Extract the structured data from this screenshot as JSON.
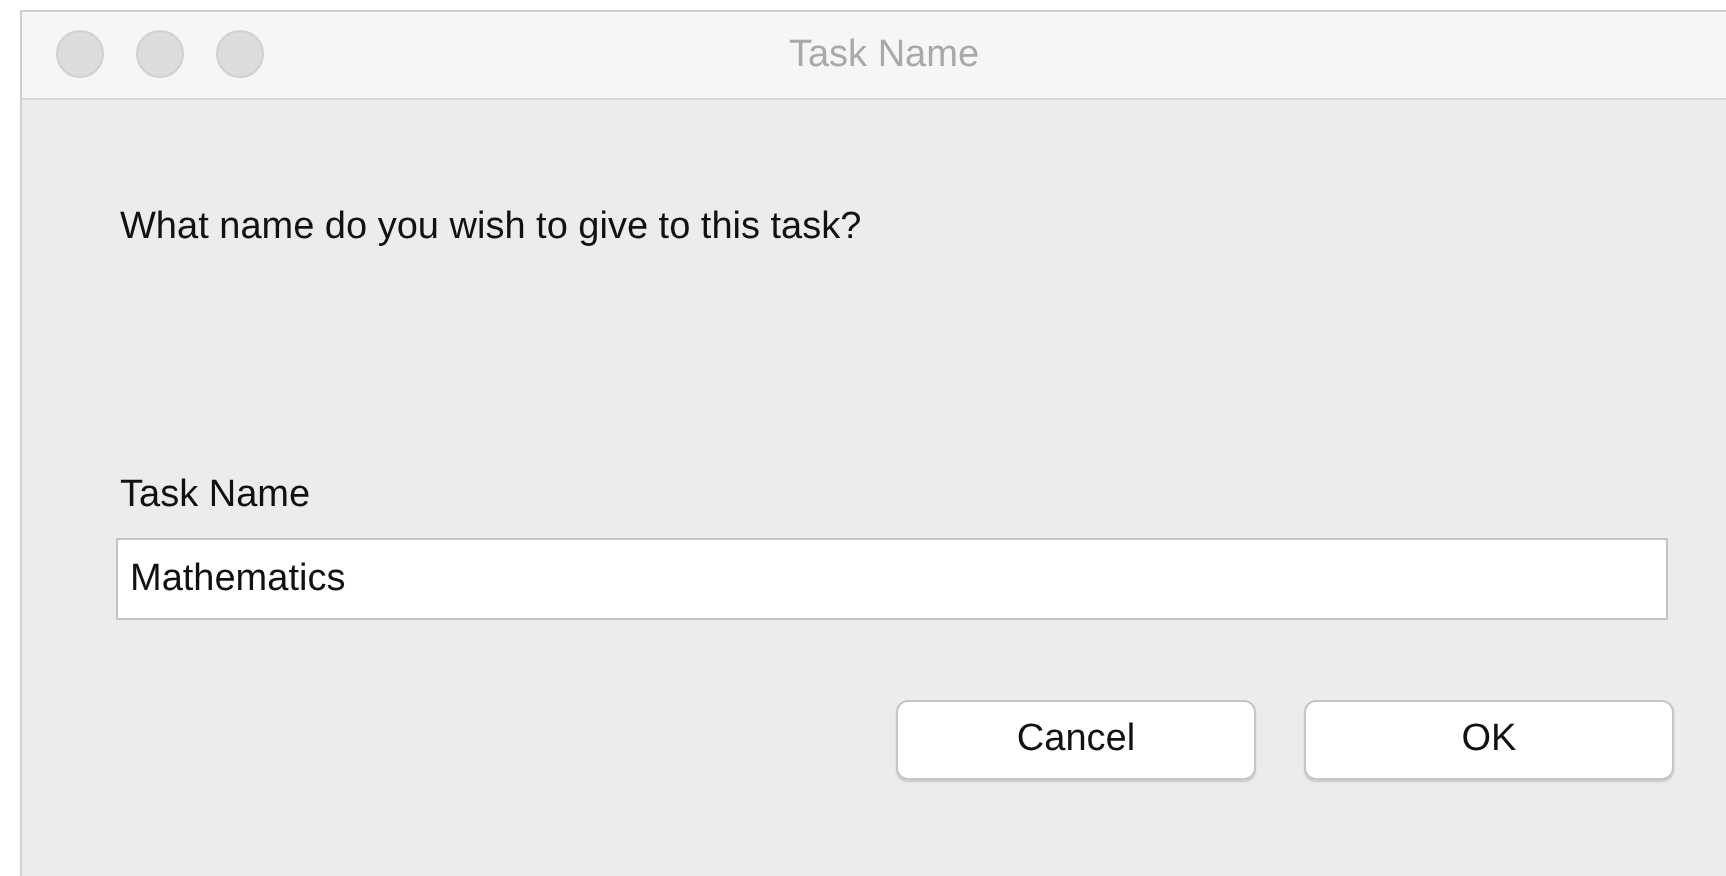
{
  "window": {
    "title": "Task Name"
  },
  "prompt": "What name do you wish to give to this task?",
  "field": {
    "label": "Task Name",
    "value": "Mathematics"
  },
  "buttons": [
    {
      "label": "Cancel"
    },
    {
      "label": "OK"
    }
  ]
}
